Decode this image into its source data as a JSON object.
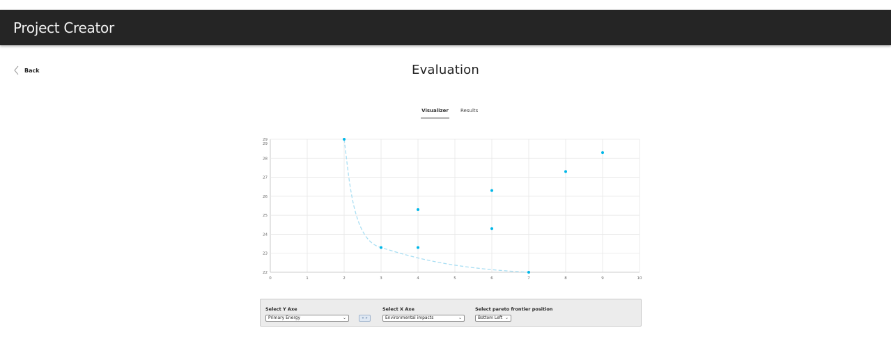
{
  "app": {
    "title": "Project Creator"
  },
  "nav": {
    "back_label": "Back"
  },
  "page": {
    "title": "Evaluation"
  },
  "tabs": [
    {
      "label": "Visualizer",
      "active": true
    },
    {
      "label": "Results",
      "active": false
    }
  ],
  "controls": {
    "y_label": "Select Y Axe",
    "y_value": "Primary Energy",
    "swap_label": "« »",
    "x_label": "Select X Axe",
    "x_value": "Environmental impacts",
    "pareto_label": "Select pareto frontier position",
    "pareto_value": "Bottom Left"
  },
  "colors": {
    "point": "#00b7e8",
    "frontier": "#a8def3",
    "grid": "#e6e6e6",
    "appbar": "#252525"
  },
  "chart_data": {
    "type": "scatter",
    "xlim": [
      0,
      10
    ],
    "ylim": [
      22,
      29
    ],
    "x_ticks": [
      "0",
      "1",
      "2",
      "3",
      "4",
      "5",
      "6",
      "7",
      "8",
      "9",
      "10"
    ],
    "y_ticks": [
      "22",
      "23",
      "24",
      "25",
      "26",
      "27",
      "28",
      "29",
      "29"
    ],
    "grid": true,
    "points": [
      {
        "x": 2,
        "y": 29
      },
      {
        "x": 3,
        "y": 23.3
      },
      {
        "x": 4,
        "y": 25.3
      },
      {
        "x": 4,
        "y": 23.3
      },
      {
        "x": 6,
        "y": 26.3
      },
      {
        "x": 6,
        "y": 24.3
      },
      {
        "x": 7,
        "y": 22
      },
      {
        "x": 8,
        "y": 27.3
      },
      {
        "x": 9,
        "y": 28.3
      }
    ],
    "pareto_frontier": [
      {
        "x": 2,
        "y": 29
      },
      {
        "x": 3,
        "y": 23.3
      },
      {
        "x": 7,
        "y": 22
      }
    ]
  }
}
